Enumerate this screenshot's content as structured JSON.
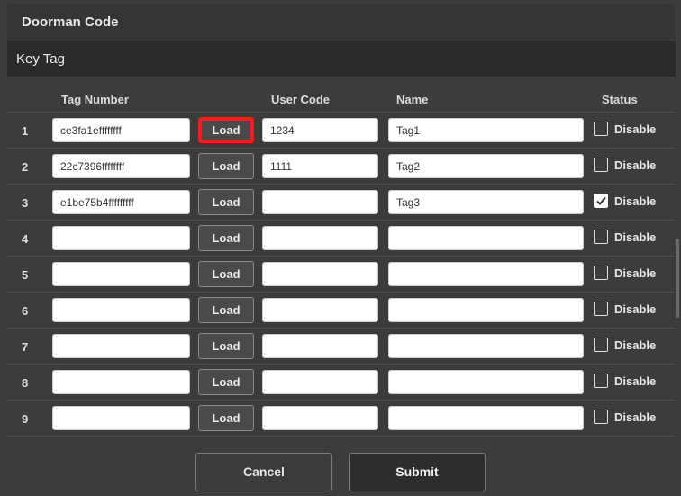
{
  "header": {
    "title": "Doorman Code"
  },
  "subheader": {
    "title": "Key Tag"
  },
  "table": {
    "columns": {
      "tag_number": "Tag Number",
      "user_code": "User Code",
      "name": "Name",
      "status": "Status"
    },
    "rows": [
      {
        "num": "1",
        "tag": "ce3fa1effffffff",
        "load": "Load",
        "user": "1234",
        "name": "Tag1",
        "status": "Disable",
        "checked": false,
        "load_highlight": true
      },
      {
        "num": "2",
        "tag": "22c7396ffffffff",
        "load": "Load",
        "user": "1111",
        "name": "Tag2",
        "status": "Disable",
        "checked": false,
        "load_highlight": false
      },
      {
        "num": "3",
        "tag": "e1be75b4fffffffff",
        "load": "Load",
        "user": "",
        "name": "Tag3",
        "status": "Disable",
        "checked": true,
        "load_highlight": false
      },
      {
        "num": "4",
        "tag": "",
        "load": "Load",
        "user": "",
        "name": "",
        "status": "Disable",
        "checked": false,
        "load_highlight": false
      },
      {
        "num": "5",
        "tag": "",
        "load": "Load",
        "user": "",
        "name": "",
        "status": "Disable",
        "checked": false,
        "load_highlight": false
      },
      {
        "num": "6",
        "tag": "",
        "load": "Load",
        "user": "",
        "name": "",
        "status": "Disable",
        "checked": false,
        "load_highlight": false
      },
      {
        "num": "7",
        "tag": "",
        "load": "Load",
        "user": "",
        "name": "",
        "status": "Disable",
        "checked": false,
        "load_highlight": false
      },
      {
        "num": "8",
        "tag": "",
        "load": "Load",
        "user": "",
        "name": "",
        "status": "Disable",
        "checked": false,
        "load_highlight": false
      },
      {
        "num": "9",
        "tag": "",
        "load": "Load",
        "user": "",
        "name": "",
        "status": "Disable",
        "checked": false,
        "load_highlight": false
      }
    ]
  },
  "footer": {
    "cancel_label": "Cancel",
    "submit_label": "Submit"
  },
  "colors": {
    "highlight": "#ff1a1a",
    "background": "#3c3c3c"
  }
}
